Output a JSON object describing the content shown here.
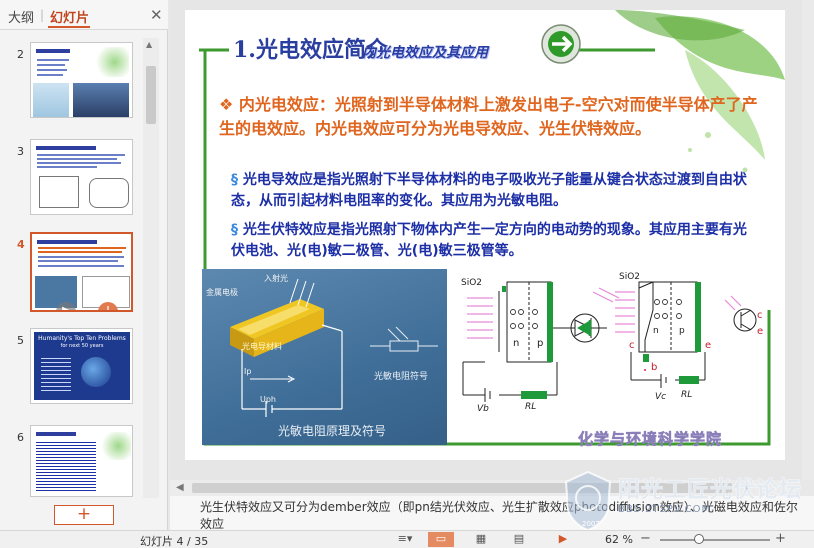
{
  "pane": {
    "tab_outline": "大纲",
    "tab_separator": "|",
    "tab_slides": "幻灯片",
    "close_glyph": "✕",
    "add_glyph": "+",
    "thumbnails": [
      {
        "number": "2"
      },
      {
        "number": "3"
      },
      {
        "number": "4"
      },
      {
        "number": "5"
      },
      {
        "number": "6"
      }
    ],
    "thumb5_title": "Humanity's Top Ten Problems",
    "thumb5_subtitle": "for next 50 years"
  },
  "slide": {
    "title_main": "1.光电效应简介",
    "title_sub": "内光电效应及其应用",
    "bullet_main_marker": "❖",
    "bullet_main": "内光电效应：光照射到半导体材料上激发出电子-空穴对而使半导体产了产生的电效应。内光电效应可分为光电导效应、光生伏特效应。",
    "sub_marker": "§",
    "bullet_sub1": "光电导效应是指光照射下半导体材料的电子吸收光子能量从键合状态过渡到自由状态，从而引起材料电阻率的变化。其应用为光敏电阻。",
    "bullet_sub2": "光生伏特效应是指光照射下物体内产生一定方向的电动势的现象。其应用主要有光伏电池、光(电)敏二极管、光(电)敏三极管等。",
    "photo": {
      "label_incident": "入射光",
      "label_metal": "金属电极",
      "label_material": "光电导材料",
      "label_ip": "Ip",
      "label_uph": "Uph",
      "label_symbol": "光敏电阻符号",
      "caption": "光敏电阻原理及符号"
    },
    "diagram": {
      "sio2_left": "SiO2",
      "sio2_right": "SiO2",
      "n": "n",
      "p": "p",
      "vb": "Vb",
      "rl_left": "RL",
      "rl_right": "RL",
      "vc": "Vc",
      "c": "c",
      "b": "b",
      "e": "e"
    },
    "college": "化学与环境科学学院"
  },
  "notes": {
    "text": "光生伏特效应又可分为dember效应（即pn结光伏效应、光生扩散效应photodiffusion效应）、光磁电效应和佐尔效应"
  },
  "status": {
    "slide_counter": "幻灯片 4 / 35",
    "zoom": "62 %",
    "zoom_value": 62
  },
  "watermark": {
    "title": "阳光工匠光伏论坛",
    "url": "BBS.2TSPV.COM",
    "year": "2007"
  },
  "colors": {
    "accent": "#d2582c",
    "title_blue": "#2a3ea0",
    "frame_green": "#3d9a2e"
  }
}
